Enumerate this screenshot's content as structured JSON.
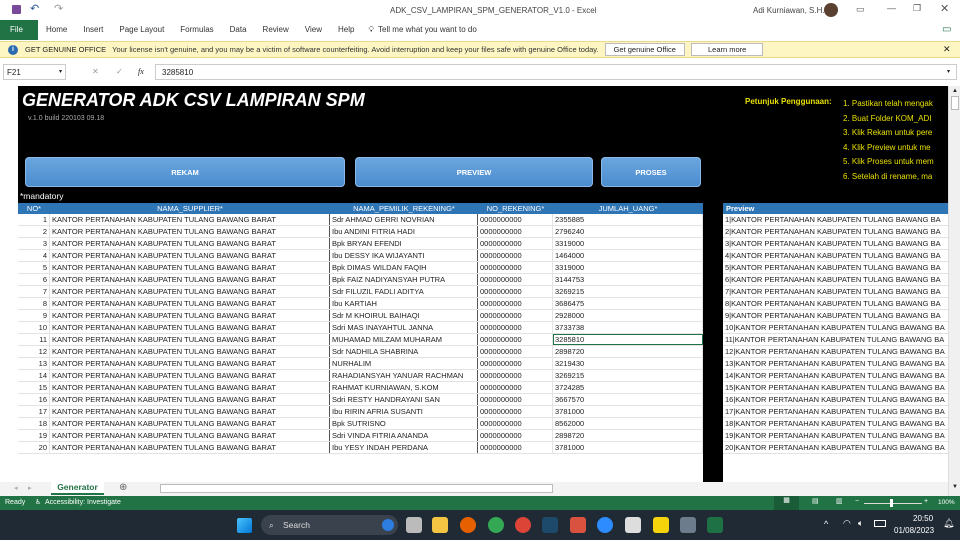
{
  "window": {
    "title": "ADK_CSV_LAMPIRAN_SPM_GENERATOR_V1.0  -  Excel",
    "user": "Adi Kurniawan, S.H."
  },
  "ribbon": {
    "tabs": [
      "File",
      "Home",
      "Insert",
      "Page Layout",
      "Formulas",
      "Data",
      "Review",
      "View",
      "Help"
    ],
    "tell_me": "Tell me what you want to do"
  },
  "warning": {
    "title": "GET GENUINE OFFICE",
    "message": "Your license isn't genuine, and you may be a victim of software counterfeiting. Avoid interruption and keep your files safe with genuine Office today.",
    "btn_get": "Get genuine Office",
    "btn_learn": "Learn more"
  },
  "formula_bar": {
    "name_box": "F21",
    "fx": "fx",
    "value": "3285810"
  },
  "sheet": {
    "title": "GENERATOR ADK CSV LAMPIRAN SPM",
    "version": "v.1.0  build 220103 09.18",
    "buttons": {
      "rekam": "REKAM",
      "preview": "PREVIEW",
      "proses": "PROSES"
    },
    "mandatory": "*mandatory",
    "instructions_label": "Petunjuk Penggunaan:",
    "instructions": [
      "1. Pastikan telah mengak",
      "2. Buat Folder  KOM_ADI",
      "3. Klik Rekam untuk pere",
      "4. Klik Preview untuk me",
      "5. Klik Proses untuk mem",
      "6. Setelah di rename, ma"
    ],
    "headers": [
      "NO*",
      "NAMA_SUPPLIER*",
      "NAMA_PEMILIK_REKENING*",
      "NO_REKENING*",
      "JUMLAH_UANG*"
    ],
    "preview_header": "Preview",
    "rows": [
      [
        "1",
        "KANTOR PERTANAHAN KABUPATEN TULANG BAWANG BARAT",
        "Sdr AHMAD GERRI NOVRIAN",
        "0000000000",
        "2355885"
      ],
      [
        "2",
        "KANTOR PERTANAHAN KABUPATEN TULANG BAWANG BARAT",
        "Ibu ANDINI FITRIA HADI",
        "0000000000",
        "2796240"
      ],
      [
        "3",
        "KANTOR PERTANAHAN KABUPATEN TULANG BAWANG BARAT",
        "Bpk BRYAN EFENDI",
        "0000000000",
        "3319000"
      ],
      [
        "4",
        "KANTOR PERTANAHAN KABUPATEN TULANG BAWANG BARAT",
        "Ibu DESSY IKA WIJAYANTI",
        "0000000000",
        "1464000"
      ],
      [
        "5",
        "KANTOR PERTANAHAN KABUPATEN TULANG BAWANG BARAT",
        "Bpk DIMAS WILDAN FAQIH",
        "0000000000",
        "3319000"
      ],
      [
        "6",
        "KANTOR PERTANAHAN KABUPATEN TULANG BAWANG BARAT",
        "Bpk FAIZ NADIYANSYAH PUTRA",
        "0000000000",
        "3144753"
      ],
      [
        "7",
        "KANTOR PERTANAHAN KABUPATEN TULANG BAWANG BARAT",
        "Sdr FILUZIL FADLI ADITYA",
        "0000000000",
        "3269215"
      ],
      [
        "8",
        "KANTOR PERTANAHAN KABUPATEN TULANG BAWANG BARAT",
        "Ibu KARTIAH",
        "0000000000",
        "3686475"
      ],
      [
        "9",
        "KANTOR PERTANAHAN KABUPATEN TULANG BAWANG BARAT",
        "Sdr M KHOIRUL BAIHAQI",
        "0000000000",
        "2928000"
      ],
      [
        "10",
        "KANTOR PERTANAHAN KABUPATEN TULANG BAWANG BARAT",
        "Sdri MAS INAYAHTUL JANNA",
        "0000000000",
        "3733738"
      ],
      [
        "11",
        "KANTOR PERTANAHAN KABUPATEN TULANG BAWANG BARAT",
        "MUHAMAD MILZAM MUHARAM",
        "0000000000",
        "3285810"
      ],
      [
        "12",
        "KANTOR PERTANAHAN KABUPATEN TULANG BAWANG BARAT",
        "Sdr NADHILA SHABRINA",
        "0000000000",
        "2898720"
      ],
      [
        "13",
        "KANTOR PERTANAHAN KABUPATEN TULANG BAWANG BARAT",
        "NURHALIM",
        "0000000000",
        "3219430"
      ],
      [
        "14",
        "KANTOR PERTANAHAN KABUPATEN TULANG BAWANG BARAT",
        "RAHADIANSYAH YANUAR RACHMAN",
        "0000000000",
        "3269215"
      ],
      [
        "15",
        "KANTOR PERTANAHAN KABUPATEN TULANG BAWANG BARAT",
        "RAHMAT KURNIAWAN, S.KOM",
        "0000000000",
        "3724285"
      ],
      [
        "16",
        "KANTOR PERTANAHAN KABUPATEN TULANG BAWANG BARAT",
        "Sdri RESTY HANDRAYANI SAN",
        "0000000000",
        "3667570"
      ],
      [
        "17",
        "KANTOR PERTANAHAN KABUPATEN TULANG BAWANG BARAT",
        "Ibu RIRIN AFRIA SUSANTI",
        "0000000000",
        "3781000"
      ],
      [
        "18",
        "KANTOR PERTANAHAN KABUPATEN TULANG BAWANG BARAT",
        "Bpk SUTRISNO",
        "0000000000",
        "8562000"
      ],
      [
        "19",
        "KANTOR PERTANAHAN KABUPATEN TULANG BAWANG BARAT",
        "Sdri VINDA FITRIA ANANDA",
        "0000000000",
        "2898720"
      ],
      [
        "20",
        "KANTOR PERTANAHAN KABUPATEN TULANG BAWANG BARAT",
        "Ibu YESY INDAH PERDANA",
        "0000000000",
        "3781000"
      ]
    ],
    "preview_rows": [
      "1|KANTOR PERTANAHAN KABUPATEN TULANG BAWANG BA",
      "2|KANTOR PERTANAHAN KABUPATEN TULANG BAWANG BA",
      "3|KANTOR PERTANAHAN KABUPATEN TULANG BAWANG BA",
      "4|KANTOR PERTANAHAN KABUPATEN TULANG BAWANG BA",
      "5|KANTOR PERTANAHAN KABUPATEN TULANG BAWANG BA",
      "6|KANTOR PERTANAHAN KABUPATEN TULANG BAWANG BA",
      "7|KANTOR PERTANAHAN KABUPATEN TULANG BAWANG BA",
      "8|KANTOR PERTANAHAN KABUPATEN TULANG BAWANG BA",
      "9|KANTOR PERTANAHAN KABUPATEN TULANG BAWANG BA",
      "10|KANTOR PERTANAHAN KABUPATEN TULANG BAWANG BA",
      "11|KANTOR PERTANAHAN KABUPATEN TULANG BAWANG BA",
      "12|KANTOR PERTANAHAN KABUPATEN TULANG BAWANG BA",
      "13|KANTOR PERTANAHAN KABUPATEN TULANG BAWANG BA",
      "14|KANTOR PERTANAHAN KABUPATEN TULANG BAWANG BA",
      "15|KANTOR PERTANAHAN KABUPATEN TULANG BAWANG BA",
      "16|KANTOR PERTANAHAN KABUPATEN TULANG BAWANG BA",
      "17|KANTOR PERTANAHAN KABUPATEN TULANG BAWANG BA",
      "18|KANTOR PERTANAHAN KABUPATEN TULANG BAWANG BA",
      "19|KANTOR PERTANAHAN KABUPATEN TULANG BAWANG BA",
      "20|KANTOR PERTANAHAN KABUPATEN TULANG BAWANG BA"
    ]
  },
  "sheet_tabs": {
    "active": "Generator"
  },
  "status": {
    "ready": "Ready",
    "accessibility": "Accessibility: Investigate",
    "zoom": "100%"
  },
  "taskbar": {
    "search": "Search",
    "time": "20:50",
    "date": "01/08/2023"
  },
  "colors": {
    "excel_green": "#217346",
    "header_blue": "#2e75b6",
    "instruction_yellow": "#e8e000"
  }
}
